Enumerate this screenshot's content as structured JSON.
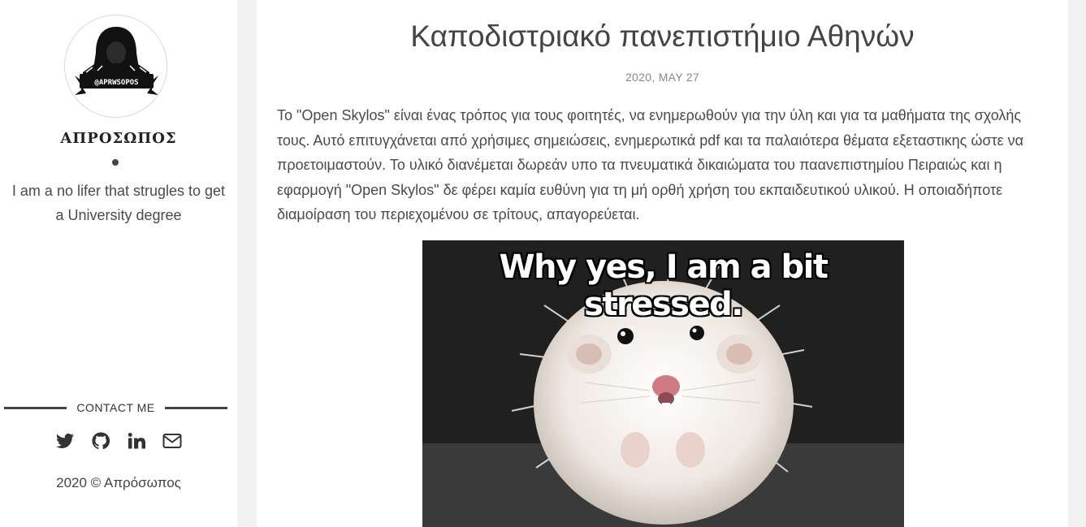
{
  "sidebar": {
    "avatar_text": "@APRWSOPOS",
    "author_name": "ΑΠΡΟΣΩΠΟΣ",
    "bio": "I am a no lifer that strugles to get a University degree",
    "contact_label": "CONTACT ME",
    "socials": [
      "twitter-icon",
      "github-icon",
      "linkedin-icon",
      "email-icon"
    ],
    "copyright": "2020 © Απρόσωπος"
  },
  "post": {
    "title": "Καποδιστριακό πανεπιστήμιο Αθηνών",
    "date": "2020, MAY 27",
    "body": "Το \"Open Skylos\" είναι ένας τρόπος για τους φοιτητές, να ενημερωθούν για την ύλη και για τα μαθήματα της σχολής τους. Αυτό επιτυγχάνεται από χρήσιμες σημειώσεις, ενημερωτικά pdf και τα παλαιότερα θέματα εξεταστικης ώστε να προετοιμαστούν. Το υλικό διανέμεται δωρεάν υπο τα πνευματικά δικαιώματα του παανεπιστημίου Πειραιώς και η εφαρμογή \"Open Skylos\" δε φέρει καμία ευθύνη για τη μή ορθή χρήση του εκπαιδευτικού υλικού. Η οποιαδήποτε διαμοίραση του περιεχομένου σε τρίτους, απαγορεύεται.",
    "image_caption": "Why yes, I am a bit stressed."
  },
  "colors": {
    "page_bg": "#f2f2f2",
    "panel_bg": "#ffffff",
    "text": "#4a4a4a",
    "muted": "#888888"
  }
}
